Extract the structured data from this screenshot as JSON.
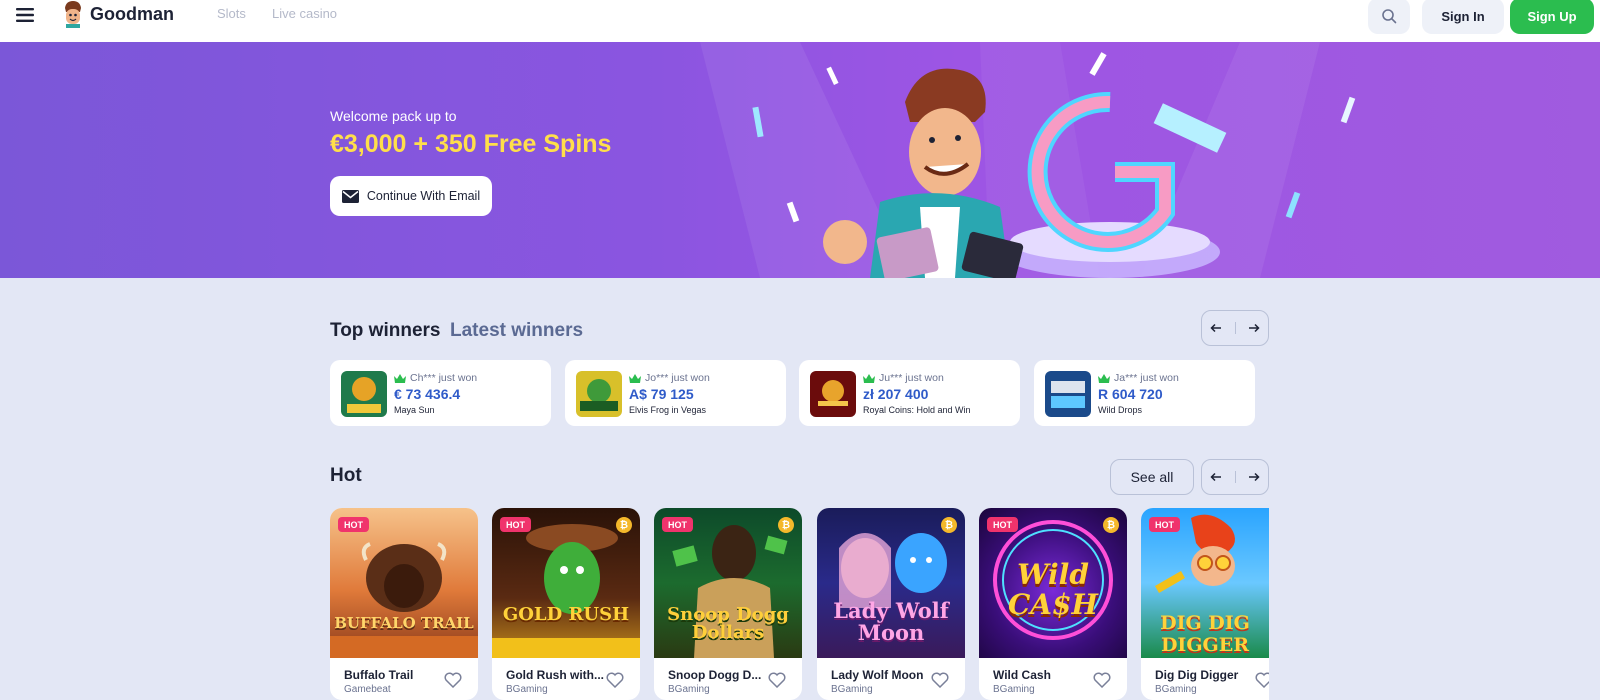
{
  "header": {
    "brand": "Goodman",
    "nav": [
      "Slots",
      "Live casino"
    ],
    "sign_in": "Sign In",
    "sign_up": "Sign Up"
  },
  "banner": {
    "welcome_small": "Welcome pack up to",
    "welcome_big": "€3,000 + 350 Free Spins",
    "email_button": "Continue With Email"
  },
  "winners": {
    "title": "Top winners",
    "alt_title": "Latest winners",
    "items": [
      {
        "user": "Ch*** just won",
        "amount": "€ 73 436.4",
        "game": "Maya Sun"
      },
      {
        "user": "Jo*** just won",
        "amount": "A$ 79 125",
        "game": "Elvis Frog in Vegas"
      },
      {
        "user": "Ju*** just won",
        "amount": "zł 207 400",
        "game": "Royal Coins: Hold and Win"
      },
      {
        "user": "Ja*** just won",
        "amount": "R 604 720",
        "game": "Wild Drops"
      }
    ]
  },
  "hot": {
    "title": "Hot",
    "see_all": "See all",
    "badge": "HOT",
    "games": [
      {
        "name": "Buffalo Trail",
        "provider": "Gamebeat",
        "art": "BUFFALO TRAIL",
        "coin": false
      },
      {
        "name": "Gold Rush with...",
        "provider": "BGaming",
        "art": "GOLD RUSH",
        "coin": true
      },
      {
        "name": "Snoop Dogg D...",
        "provider": "BGaming",
        "art": "Snoop Dogg Dollars",
        "coin": true
      },
      {
        "name": "Lady Wolf Moon",
        "provider": "BGaming",
        "art": "Lady Wolf Moon",
        "coin": true
      },
      {
        "name": "Wild Cash",
        "provider": "BGaming",
        "art": "Wild CA$H",
        "coin": true
      },
      {
        "name": "Dig Dig Digger",
        "provider": "BGaming",
        "art": "DIG DIG DIGGER",
        "coin": true
      }
    ]
  },
  "colors": {
    "accent_green": "#2bbd4f",
    "promo_yellow": "#ffdf4a",
    "hot_pink": "#f0336c",
    "amount_blue": "#2f5bc9"
  }
}
